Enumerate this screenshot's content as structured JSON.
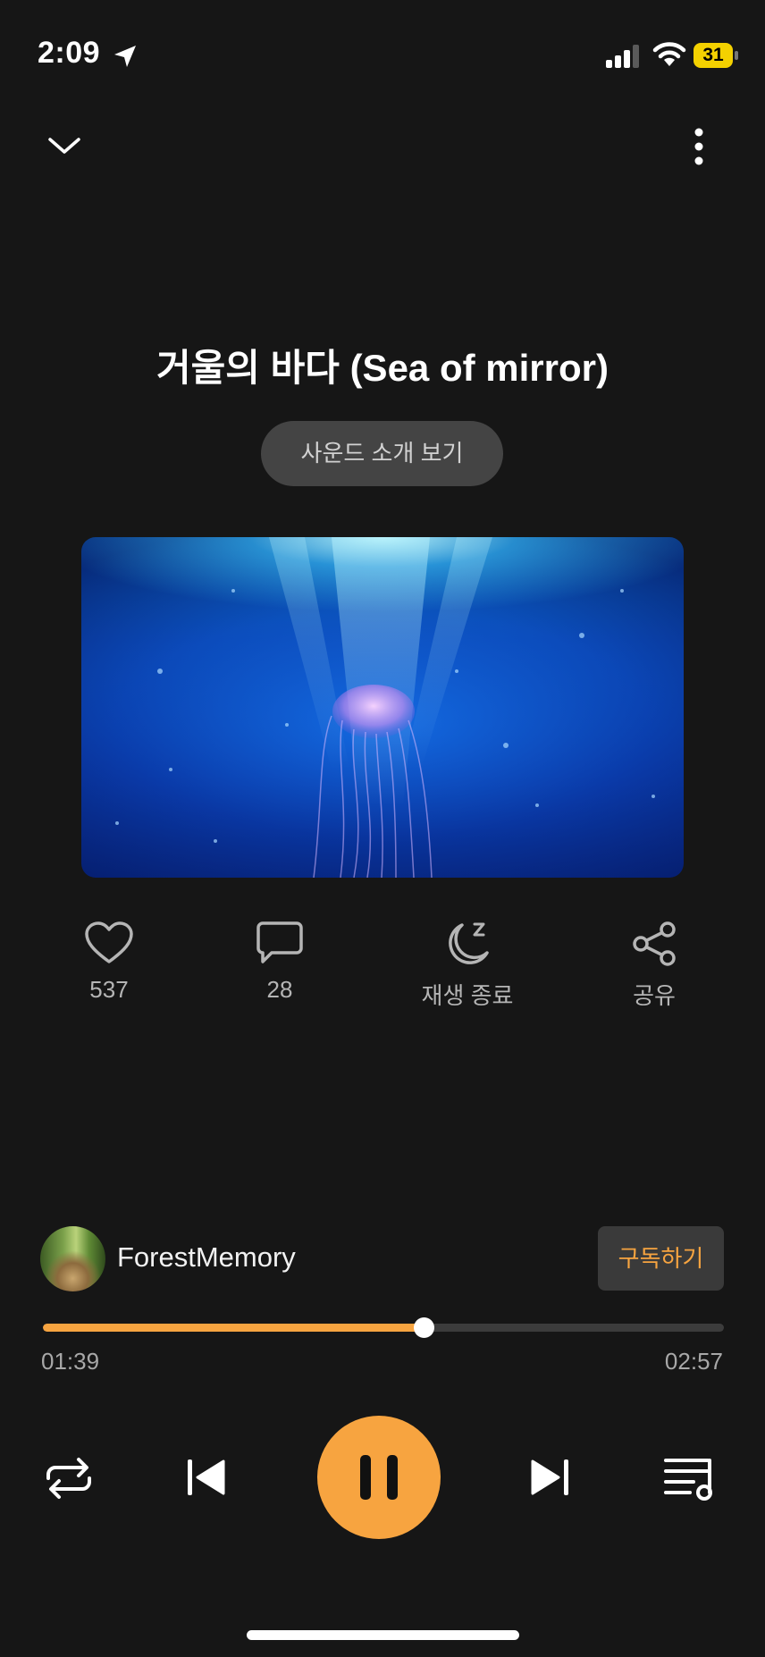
{
  "status_bar": {
    "time": "2:09",
    "battery": "31",
    "battery_color": "#f4d100"
  },
  "track": {
    "title": "거울의 바다 (Sea of mirror)"
  },
  "intro_button_label": "사운드 소개 보기",
  "actions": {
    "like_count": "537",
    "comment_count": "28",
    "sleep_timer_label": "재생 종료",
    "share_label": "공유"
  },
  "channel": {
    "name": "ForestMemory",
    "subscribe_label": "구독하기"
  },
  "playback": {
    "current_time": "01:39",
    "total_time": "02:57",
    "progress": 0.559,
    "state": "playing"
  },
  "icons": {
    "header": [
      "chevron-down-icon",
      "more-vertical-icon"
    ],
    "actions": [
      "heart-icon",
      "comment-icon",
      "moon-sleep-icon",
      "share-icon"
    ],
    "transport": [
      "repeat-icon",
      "skip-previous-icon",
      "pause-icon",
      "skip-next-icon",
      "playlist-icon"
    ]
  },
  "colors": {
    "accent": "#f7a440",
    "background": "#161616"
  }
}
